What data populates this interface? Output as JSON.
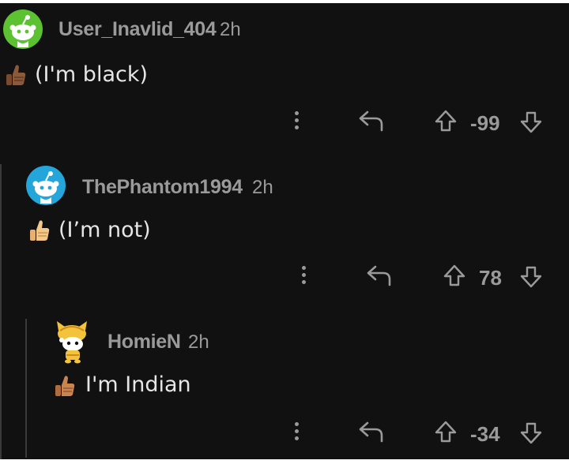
{
  "comments": [
    {
      "username": "User_Inavlid_404",
      "time": "2h",
      "body": "(I'm black)",
      "score": "-99",
      "flair_skin": "#7a4a2e",
      "avatar_bg": "#5cc232"
    },
    {
      "username": "ThePhantom1994",
      "time": "2h",
      "body": "(I’m not)",
      "score": "78",
      "flair_skin": "#f0c080",
      "avatar_bg": "#24a6da"
    },
    {
      "username": "HomieN",
      "time": "2h",
      "body": "I'm Indian",
      "score": "-34",
      "flair_skin": "#c07a4a",
      "avatar_bg": "#f3c33c"
    }
  ],
  "icons": {
    "more": "more-options-icon",
    "reply": "reply-arrow-icon",
    "upvote": "upvote-arrow-icon",
    "downvote": "downvote-arrow-icon",
    "flair": "thumbs-up-icon",
    "avatar": "snoo-avatar-icon"
  }
}
